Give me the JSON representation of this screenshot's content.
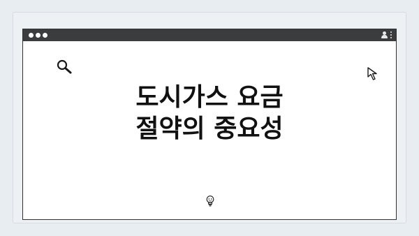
{
  "page": {
    "headline_line1": "도시가스 요금",
    "headline_line2": "절약의 중요성"
  },
  "icons": {
    "search": "search-icon",
    "cursor": "cursor-icon",
    "bulb": "lightbulb-icon",
    "user": "user-icon",
    "menu": "kebab-menu-icon"
  },
  "colors": {
    "background": "#e8edf1",
    "titlebar": "#3a3c3e",
    "browser_body": "#ffffff",
    "text": "#111111"
  }
}
